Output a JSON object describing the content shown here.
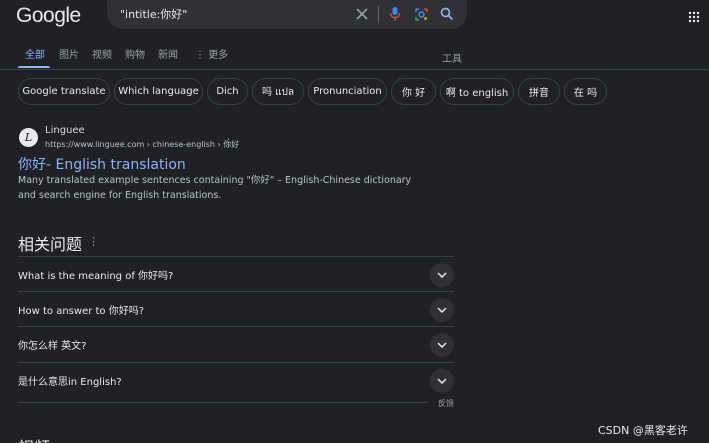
{
  "header": {
    "logo_text": "Google",
    "search": {
      "query": "\"intitle:你好\""
    }
  },
  "tabs": {
    "items": [
      {
        "label": "全部"
      },
      {
        "label": "图片"
      },
      {
        "label": "视频"
      },
      {
        "label": "购物"
      },
      {
        "label": "新闻"
      },
      {
        "label": "更多"
      }
    ],
    "tools_label": "工具"
  },
  "chips": [
    {
      "label": "Google translate"
    },
    {
      "label": "Which language"
    },
    {
      "label": "Dich"
    },
    {
      "label": "吗 แปล"
    },
    {
      "label": "Pronunciation"
    },
    {
      "label": "你 好"
    },
    {
      "label": "啊 to english"
    },
    {
      "label": "拼音"
    },
    {
      "label": "在 吗"
    }
  ],
  "result": {
    "favicon_letter": "L",
    "site_name": "Linguee",
    "url": "https://www.linguee.com › chinese-english › 你好",
    "title": "你好- English translation",
    "snippet": "Many translated example sentences containing \"你好\" – English-Chinese dictionary and search engine for English translations."
  },
  "related": {
    "title": "相关问题",
    "questions": [
      {
        "text": "What is the meaning of 你好吗?"
      },
      {
        "text": "How to answer to 你好吗?"
      },
      {
        "text": "你怎么样 英文?"
      },
      {
        "text": "是什么意思in English?"
      }
    ],
    "feedback_label": "反馈"
  },
  "bottom": {
    "section_heading": "视频",
    "watermark": "CSDN @黑客老许"
  },
  "colors": {
    "background": "#202124",
    "link": "#8ab4f8",
    "text": "#bdc1c6",
    "chip_border": "#3c4043"
  }
}
